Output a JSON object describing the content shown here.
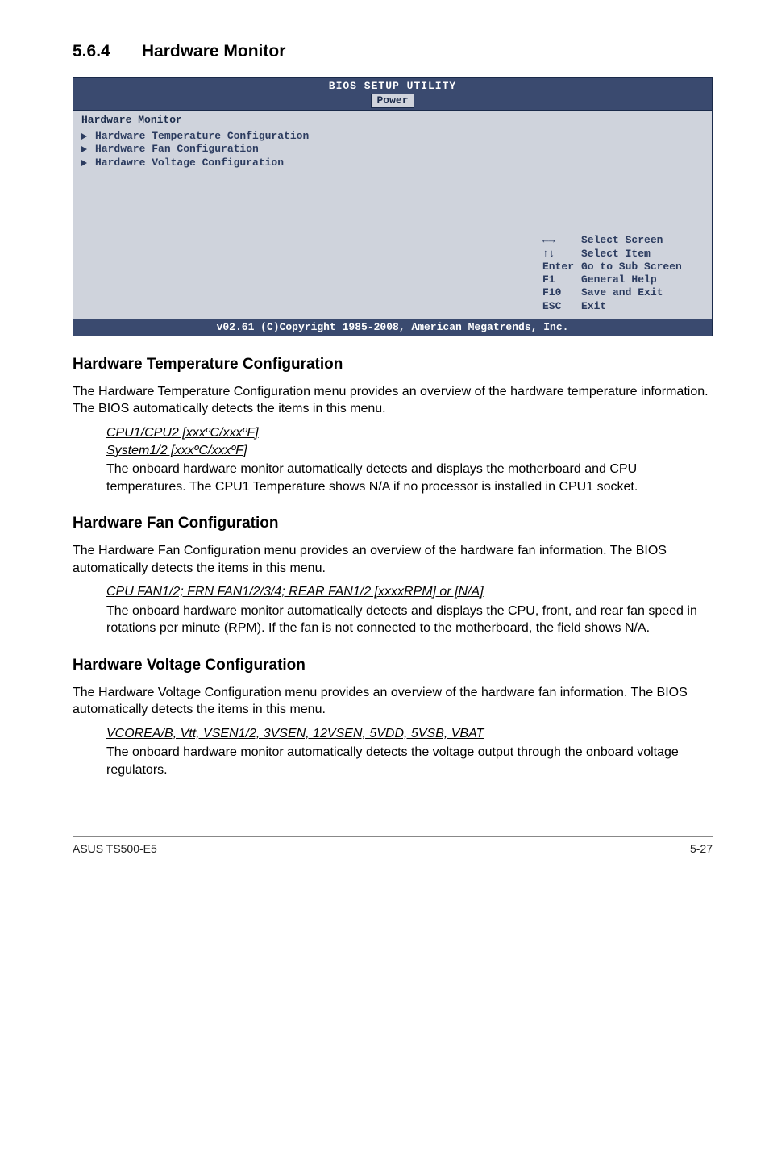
{
  "section": {
    "number": "5.6.4",
    "title": "Hardware Monitor"
  },
  "bios": {
    "title": "BIOS SETUP UTILITY",
    "tab": "Power",
    "header": "Hardware Monitor",
    "items": [
      "Hardware Temperature Configuration",
      "Hardware Fan Configuration",
      "Hardawre Voltage Configuration"
    ],
    "help": {
      "l1k": "←→",
      "l1t": "Select Screen",
      "l2k": "↑↓",
      "l2t": "Select Item",
      "l3k": "Enter",
      "l3t": "Go to Sub Screen",
      "l4k": "F1",
      "l4t": "General Help",
      "l5k": "F10",
      "l5t": "Save and Exit",
      "l6k": "ESC",
      "l6t": "Exit"
    },
    "copyright": "v02.61 (C)Copyright 1985-2008, American Megatrends, Inc."
  },
  "htc": {
    "heading": "Hardware Temperature Configuration",
    "intro": "The Hardware Temperature Configuration menu provides an overview of the hardware temperature information. The BIOS automatically detects the items in this menu.",
    "u1": "CPU1/CPU2 [xxxºC/xxxºF]",
    "u2": "System1/2 [xxxºC/xxxºF]",
    "body": "The onboard hardware monitor automatically detects and displays the motherboard and CPU temperatures. The CPU1 Temperature shows N/A if no processor is installed in CPU1 socket."
  },
  "hfc": {
    "heading": "Hardware Fan Configuration",
    "intro": "The Hardware Fan Configuration menu provides an overview of the hardware fan information. The BIOS automatically detects the items in this menu.",
    "u1": "CPU FAN1/2; FRN FAN1/2/3/4; REAR FAN1/2 [xxxxRPM] or [N/A]",
    "body": "The onboard hardware monitor automatically detects and displays the CPU, front, and rear fan speed in rotations per minute (RPM). If the fan is not connected to the motherboard, the field shows N/A."
  },
  "hvc": {
    "heading": "Hardware Voltage Configuration",
    "intro": "The Hardware Voltage Configuration menu provides an overview of the hardware fan information. The BIOS automatically detects the items in this menu.",
    "u1": "VCOREA/B, Vtt, VSEN1/2, 3VSEN, 12VSEN, 5VDD, 5VSB, VBAT",
    "body": "The onboard hardware monitor automatically detects the voltage output through the onboard voltage regulators."
  },
  "footer": {
    "left": "ASUS TS500-E5",
    "right": "5-27"
  }
}
